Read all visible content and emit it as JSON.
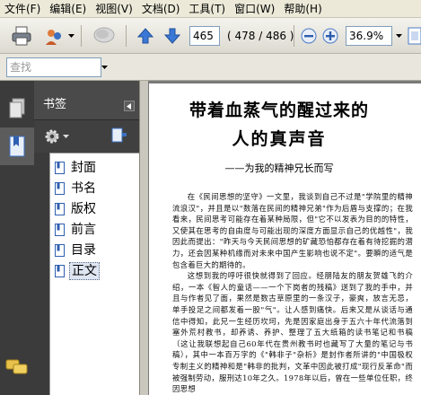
{
  "menu": [
    "文件(F)",
    "编辑(E)",
    "视图(V)",
    "文档(D)",
    "工具(T)",
    "窗口(W)",
    "帮助(H)"
  ],
  "toolbar": {
    "page_current": "465",
    "page_total": "( 478 / 486 )",
    "zoom": "36.9%"
  },
  "search": {
    "placeholder": "查找"
  },
  "nav": {
    "title": "书签",
    "bookmarks": [
      "封面",
      "书名",
      "版权",
      "前言",
      "目录",
      "正文"
    ],
    "selected_index": 5
  },
  "document": {
    "title_line1": "带着血蒸气的醒过来的",
    "title_line2": "人的真声音",
    "subtitle": "——为我的精神兄长而写",
    "paragraphs": [
      "在《民间思想的坚守》一文里，我谈到自己不过是\"学院里的精神流浪汉\"，并且是以\"数落在民间的精神兄弟\"作为后盾与支撑的；在我看来，民间思考可能存在着某种局限，但\"它不以发表为目的的特性，又使其在思考的自由度与可能出现的深度方面显示自己的优越性\"，我因此而提出：\"昨天与今天民间思想的矿藏恐怕都存在着有待挖掘的潜力，还会因某种机缘而对未来中国产生影响也说不定\"。要瞬的适气是包含着巨大的期待的。",
      "这想到我的呼吁很快就得到了回应。经朋陆友的朋友贺雄飞的介绍，一本《智人的童话——一个下岗者的残稿》送到了我的手中，并且与作者见了面，果然是数古草原里的一条汉子，豪爽，放言无忌，单手投足之间都发着一股\"气\"。让人感到痛快。后来又是从谈话与通信中得知，此兄一生经历坎坷，先是因家庭出身于五六十年代流落到塞外荒村教书，却养诱、养护、整理了五大纸箱的读书笔记和书稿（这让我联想起自己60年代在贵州教书时也藏写了大量的笔记与书稿），其中一本百万字的《\"韩非子\"杂析》是封作者所讲的\"中国极权专制主义的精神和是\"韩非的批判，文革中因此被打成\"现行反革命\"而被强制劳动，服刑达10年之久。1978年以后，曾在一些单位任职，终因思想"
    ]
  }
}
